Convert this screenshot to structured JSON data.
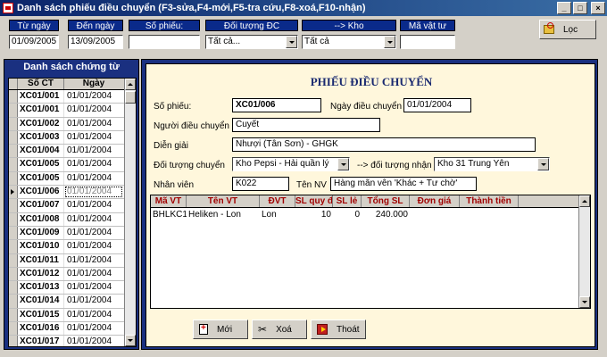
{
  "window": {
    "title": "Danh sách phiếu điều chuyển (F3-sửa,F4-mới,F5-tra cứu,F8-xoá,F10-nhận)",
    "title_buttons": [
      "_",
      "□",
      "×"
    ]
  },
  "filter": {
    "from_date_label": "Từ ngày",
    "from_date_value": "01/09/2005",
    "to_date_label": "Đến ngày",
    "to_date_value": "13/09/2005",
    "doc_no_label": "Số phiếu:",
    "doc_no_value": "",
    "target_label": "Đối tượng ĐC",
    "target_value": "Tất cả...",
    "warehouse_label": "--> Kho",
    "warehouse_value": "Tất cả",
    "item_code_label": "Mã vật tư",
    "item_code_value": "",
    "find_button": "Lọc"
  },
  "list": {
    "title": "Danh sách chứng từ",
    "col_doc": "Số CT",
    "col_date": "Ngày",
    "rows": [
      {
        "doc": "XC01/001",
        "date": "01/01/2004"
      },
      {
        "doc": "XC01/001",
        "date": "01/01/2004"
      },
      {
        "doc": "XC01/002",
        "date": "01/01/2004"
      },
      {
        "doc": "XC01/003",
        "date": "01/01/2004"
      },
      {
        "doc": "XC01/004",
        "date": "01/01/2004"
      },
      {
        "doc": "XC01/005",
        "date": "01/01/2004"
      },
      {
        "doc": "XC01/005",
        "date": "01/01/2004"
      },
      {
        "doc": "XC01/006",
        "date": "01/01/2004"
      },
      {
        "doc": "XC01/007",
        "date": "01/01/2004"
      },
      {
        "doc": "XC01/008",
        "date": "01/01/2004"
      },
      {
        "doc": "XC01/009",
        "date": "01/01/2004"
      },
      {
        "doc": "XC01/010",
        "date": "01/01/2004"
      },
      {
        "doc": "XC01/011",
        "date": "01/01/2004"
      },
      {
        "doc": "XC01/012",
        "date": "01/01/2004"
      },
      {
        "doc": "XC01/013",
        "date": "01/01/2004"
      },
      {
        "doc": "XC01/014",
        "date": "01/01/2004"
      },
      {
        "doc": "XC01/015",
        "date": "01/01/2004"
      },
      {
        "doc": "XC01/016",
        "date": "01/01/2004"
      },
      {
        "doc": "XC01/017",
        "date": "01/01/2004"
      }
    ]
  },
  "form": {
    "title": "PHIẾU ĐIỀU CHUYỂN",
    "doc_no_label": "Số phiếu:",
    "doc_no": "XC01/006",
    "date_label": "Ngày điều chuyển",
    "date": "01/01/2004",
    "person_label": "Người điều chuyển",
    "person": "Cuyết",
    "note_label": "Diễn giải",
    "note": "Nhượi (Tân Sơn) - GHGK",
    "from_label": "Đối tượng chuyển",
    "from_value": "Kho Pepsi - Hải quần lý",
    "to_label": "--> đối tượng nhận",
    "to_value": "Kho 31 Trung Yên",
    "staff_label": "Nhân viên",
    "staff_code": "K022",
    "staff_name_label": "Tên NV",
    "staff_name": "Hàng mãn vên 'Khác + Tư chờ'"
  },
  "detail": {
    "headers": [
      "Mã VT",
      "Tên VT",
      "ĐVT",
      "SL quy đổi",
      "SL lẻ",
      "Tổng SL",
      "Đơn giá",
      "Thành tiền"
    ],
    "rows": [
      {
        "code": "BHLKC1",
        "name": "Heliken - Lon",
        "unit": "Lon",
        "qty_conv": "10",
        "qty_odd": "0",
        "total": "240.000",
        "price": "",
        "amount": ""
      }
    ]
  },
  "actions": {
    "new": "Mới",
    "delete": "Xoá",
    "exit": "Thoát"
  }
}
